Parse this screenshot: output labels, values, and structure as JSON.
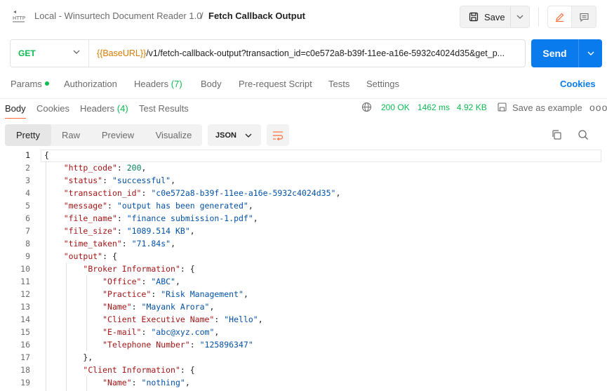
{
  "header": {
    "collection": "Local - Winsurtech Document Reader 1.0",
    "separator": "/",
    "request_name": "Fetch Callback Output",
    "save_label": "Save"
  },
  "request": {
    "method": "GET",
    "url_variable": "{{BaseURL}}",
    "url_rest": "/v1/fetch-callback-output?transaction_id=c0e572a8-b39f-11ee-a16e-5932c4024d35&get_p...",
    "send_label": "Send"
  },
  "request_tabs": {
    "params": "Params",
    "authorization": "Authorization",
    "headers": "Headers",
    "headers_count": "(7)",
    "body": "Body",
    "prerequest": "Pre-request Script",
    "tests": "Tests",
    "settings": "Settings",
    "cookies": "Cookies"
  },
  "response_tabs": {
    "body": "Body",
    "cookies": "Cookies",
    "headers": "Headers",
    "headers_count": "(4)",
    "test_results": "Test Results"
  },
  "response_meta": {
    "status": "200 OK",
    "time": "1462 ms",
    "size": "4.92 KB",
    "save_example": "Save as example",
    "more": "ooo"
  },
  "view": {
    "pretty": "Pretty",
    "raw": "Raw",
    "preview": "Preview",
    "visualize": "Visualize",
    "format": "JSON"
  },
  "code": {
    "line_numbers": [
      "1",
      "2",
      "3",
      "4",
      "5",
      "6",
      "7",
      "8",
      "9",
      "10",
      "11",
      "12",
      "13",
      "14",
      "15",
      "16",
      "17",
      "18",
      "19"
    ]
  },
  "json_response": {
    "http_code": 200,
    "status": "successful",
    "transaction_id": "c0e572a8-b39f-11ee-a16e-5932c4024d35",
    "message": "output has been generated",
    "file_name": "finance submission-1.pdf",
    "file_size": "1089.514 KB",
    "time_taken": "71.84s",
    "broker_office": "ABC",
    "broker_practice": "Risk Management",
    "broker_name": "Mayank Arora",
    "broker_client_exec": "Hello",
    "broker_email": "abc@xyz.com",
    "broker_phone": "125896347",
    "client_name": "nothing"
  },
  "colors": {
    "accent": "#097bed",
    "get_method": "#0cbb52",
    "variable": "#d97b00",
    "json_key": "#a31515",
    "json_string": "#0451a5",
    "json_number": "#098658",
    "active_tab": "#ff6c37"
  }
}
